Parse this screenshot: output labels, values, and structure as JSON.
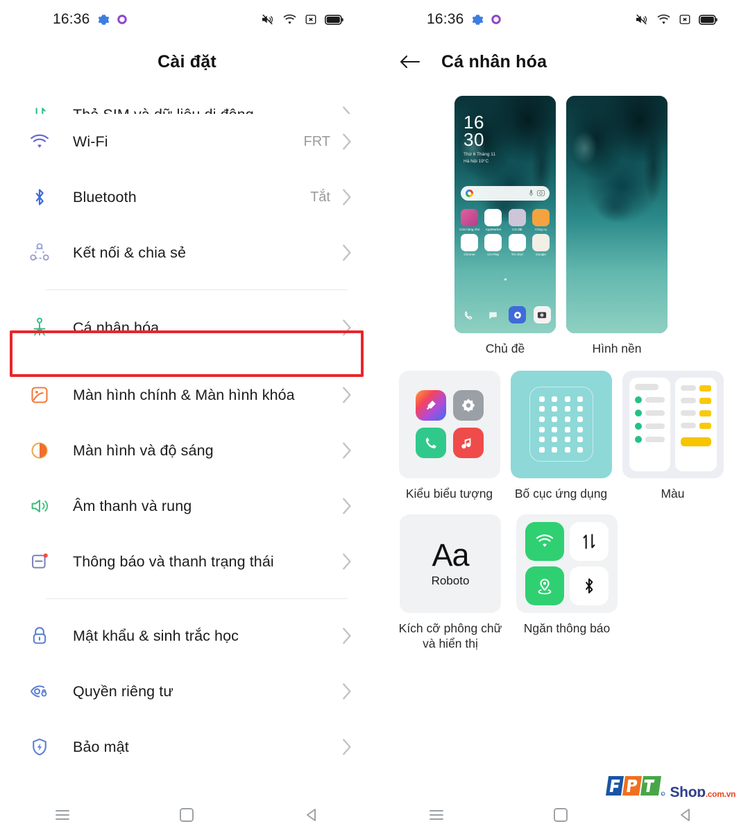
{
  "statusbar": {
    "time": "16:36",
    "left_icons": [
      "gear-icon",
      "circle-icon"
    ],
    "right_icons": [
      "vibrate-off-icon",
      "wifi-icon",
      "no-signal-icon",
      "battery-icon"
    ]
  },
  "left_pane": {
    "title": "Cài đặt",
    "items": [
      {
        "label": "Thẻ SIM và dữ liệu di động",
        "value": "",
        "icon": "sim-data-icon",
        "clipped": true
      },
      {
        "label": "Wi-Fi",
        "value": "FRT",
        "icon": "wifi-icon"
      },
      {
        "label": "Bluetooth",
        "value": "Tắt",
        "icon": "bluetooth-icon"
      },
      {
        "label": "Kết nối & chia sẻ",
        "value": "",
        "icon": "connection-share-icon"
      },
      {
        "label": "Cá nhân hóa",
        "value": "",
        "icon": "personalization-icon",
        "highlighted": true
      },
      {
        "label": "Màn hình chính & Màn hình khóa",
        "value": "",
        "icon": "home-lock-screen-icon"
      },
      {
        "label": "Màn hình và độ sáng",
        "value": "",
        "icon": "display-brightness-icon"
      },
      {
        "label": "Âm thanh và rung",
        "value": "",
        "icon": "sound-vibration-icon"
      },
      {
        "label": "Thông báo và thanh trạng thái",
        "value": "",
        "icon": "notification-statusbar-icon"
      },
      {
        "label": "Mật khẩu & sinh trắc học",
        "value": "",
        "icon": "password-biometric-icon"
      },
      {
        "label": "Quyền riêng tư",
        "value": "",
        "icon": "privacy-icon"
      },
      {
        "label": "Bảo mật",
        "value": "",
        "icon": "security-icon"
      }
    ]
  },
  "right_pane": {
    "title": "Cá nhân hóa",
    "back_icon": "back-arrow-icon",
    "cards": [
      {
        "label": "Chủ đề",
        "type": "theme-preview"
      },
      {
        "label": "Hình nền",
        "type": "wallpaper-preview"
      },
      {
        "label": "Kiểu biểu tượng",
        "type": "icon-style"
      },
      {
        "label": "Bố cục ứng dụng",
        "type": "app-layout"
      },
      {
        "label": "Màu",
        "type": "color"
      },
      {
        "label": "Kích cỡ phông chữ và hiển thị",
        "type": "font-size"
      },
      {
        "label": "Ngăn thông báo",
        "type": "notification-panel"
      }
    ],
    "theme_preview": {
      "clock_hours": "16",
      "clock_minutes": "30",
      "clock_sub_line1": "Thứ 6 Tháng 11",
      "clock_sub_line2": "Hà Nội 19°C",
      "search_icons": [
        "google-icon",
        "mic-icon",
        "lens-icon"
      ],
      "app_rows": [
        [
          {
            "name": "Cửa hàng chủ đề",
            "color": "#d64a8e"
          },
          {
            "name": "AppMarket",
            "color": "#ffffff"
          },
          {
            "name": "Cài đặt",
            "color": "#c9c4d6"
          },
          {
            "name": "Công cụ",
            "color": "#f3a64a"
          }
        ],
        [
          {
            "name": "Chrome",
            "color": "#ffffff"
          },
          {
            "name": "CH Play",
            "color": "#ffffff"
          },
          {
            "name": "Trò chơi",
            "color": "#ffffff"
          },
          {
            "name": "Google",
            "color": "#ffffff"
          }
        ]
      ],
      "dock": [
        "phone-icon",
        "messages-icon",
        "browser-icon",
        "camera-icon"
      ]
    },
    "font_card": {
      "sample": "Aa",
      "font_name": "Roboto"
    },
    "notification_card": {
      "tiles": [
        "wifi-icon",
        "data-transfer-icon",
        "location-icon",
        "bluetooth-icon"
      ]
    }
  },
  "footer": {
    "logo_letters": "FPT",
    "logo_text": "Shop",
    "logo_domain": ".com.vn"
  },
  "navbar": {
    "buttons": [
      {
        "name": "recents-button",
        "icon": "menu-lines-icon"
      },
      {
        "name": "home-button",
        "icon": "square-icon"
      },
      {
        "name": "back-button",
        "icon": "triangle-left-icon"
      }
    ]
  },
  "colors": {
    "accent_red": "#e8262b",
    "wifi_blue": "#6a6bd4",
    "bluetooth_blue": "#3f6bd8",
    "green": "#2fbf7f",
    "orange": "#f07b3f",
    "yellow": "#f7c400"
  }
}
